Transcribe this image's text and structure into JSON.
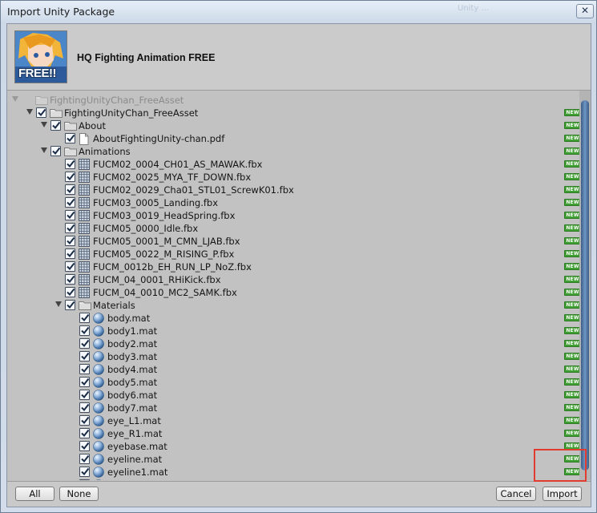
{
  "window": {
    "title": "Import Unity Package",
    "close_glyph": "✕",
    "background_text": "Unity ..."
  },
  "package": {
    "title": "HQ Fighting Animation FREE",
    "icon_badge": "FREE!!"
  },
  "new_badge": "NEW",
  "tree": [
    {
      "label": "FightingUnityChan_FreeAsset",
      "depth": 0,
      "kind": "folder",
      "expanded": true,
      "checked": null,
      "dim": true,
      "is_new": false
    },
    {
      "label": "FightingUnityChan_FreeAsset",
      "depth": 1,
      "kind": "folder",
      "expanded": true,
      "checked": true,
      "dim": false,
      "is_new": true
    },
    {
      "label": "About",
      "depth": 2,
      "kind": "folder",
      "expanded": true,
      "checked": true,
      "dim": false,
      "is_new": true
    },
    {
      "label": "AboutFightingUnity-chan.pdf",
      "depth": 3,
      "kind": "file",
      "checked": true,
      "dim": false,
      "is_new": true
    },
    {
      "label": "Animations",
      "depth": 2,
      "kind": "folder",
      "expanded": true,
      "checked": true,
      "dim": false,
      "is_new": true
    },
    {
      "label": "FUCM02_0004_CH01_AS_MAWAK.fbx",
      "depth": 3,
      "kind": "fbx",
      "checked": true,
      "dim": false,
      "is_new": true
    },
    {
      "label": "FUCM02_0025_MYA_TF_DOWN.fbx",
      "depth": 3,
      "kind": "fbx",
      "checked": true,
      "dim": false,
      "is_new": true
    },
    {
      "label": "FUCM02_0029_Cha01_STL01_ScrewK01.fbx",
      "depth": 3,
      "kind": "fbx",
      "checked": true,
      "dim": false,
      "is_new": true
    },
    {
      "label": "FUCM03_0005_Landing.fbx",
      "depth": 3,
      "kind": "fbx",
      "checked": true,
      "dim": false,
      "is_new": true
    },
    {
      "label": "FUCM03_0019_HeadSpring.fbx",
      "depth": 3,
      "kind": "fbx",
      "checked": true,
      "dim": false,
      "is_new": true
    },
    {
      "label": "FUCM05_0000_Idle.fbx",
      "depth": 3,
      "kind": "fbx",
      "checked": true,
      "dim": false,
      "is_new": true
    },
    {
      "label": "FUCM05_0001_M_CMN_LJAB.fbx",
      "depth": 3,
      "kind": "fbx",
      "checked": true,
      "dim": false,
      "is_new": true
    },
    {
      "label": "FUCM05_0022_M_RISING_P.fbx",
      "depth": 3,
      "kind": "fbx",
      "checked": true,
      "dim": false,
      "is_new": true
    },
    {
      "label": "FUCM_0012b_EH_RUN_LP_NoZ.fbx",
      "depth": 3,
      "kind": "fbx",
      "checked": true,
      "dim": false,
      "is_new": true
    },
    {
      "label": "FUCM_04_0001_RHiKick.fbx",
      "depth": 3,
      "kind": "fbx",
      "checked": true,
      "dim": false,
      "is_new": true
    },
    {
      "label": "FUCM_04_0010_MC2_SAMK.fbx",
      "depth": 3,
      "kind": "fbx",
      "checked": true,
      "dim": false,
      "is_new": true
    },
    {
      "label": "Materials",
      "depth": 3,
      "kind": "folder",
      "expanded": true,
      "checked": true,
      "dim": false,
      "is_new": true
    },
    {
      "label": "body.mat",
      "depth": 4,
      "kind": "mat",
      "checked": true,
      "dim": false,
      "is_new": true
    },
    {
      "label": "body1.mat",
      "depth": 4,
      "kind": "mat",
      "checked": true,
      "dim": false,
      "is_new": true
    },
    {
      "label": "body2.mat",
      "depth": 4,
      "kind": "mat",
      "checked": true,
      "dim": false,
      "is_new": true
    },
    {
      "label": "body3.mat",
      "depth": 4,
      "kind": "mat",
      "checked": true,
      "dim": false,
      "is_new": true
    },
    {
      "label": "body4.mat",
      "depth": 4,
      "kind": "mat",
      "checked": true,
      "dim": false,
      "is_new": true
    },
    {
      "label": "body5.mat",
      "depth": 4,
      "kind": "mat",
      "checked": true,
      "dim": false,
      "is_new": true
    },
    {
      "label": "body6.mat",
      "depth": 4,
      "kind": "mat",
      "checked": true,
      "dim": false,
      "is_new": true
    },
    {
      "label": "body7.mat",
      "depth": 4,
      "kind": "mat",
      "checked": true,
      "dim": false,
      "is_new": true
    },
    {
      "label": "eye_L1.mat",
      "depth": 4,
      "kind": "mat",
      "checked": true,
      "dim": false,
      "is_new": true
    },
    {
      "label": "eye_R1.mat",
      "depth": 4,
      "kind": "mat",
      "checked": true,
      "dim": false,
      "is_new": true
    },
    {
      "label": "eyebase.mat",
      "depth": 4,
      "kind": "mat",
      "checked": true,
      "dim": false,
      "is_new": true
    },
    {
      "label": "eyeline.mat",
      "depth": 4,
      "kind": "mat",
      "checked": true,
      "dim": false,
      "is_new": true
    },
    {
      "label": "eyeline1.mat",
      "depth": 4,
      "kind": "mat",
      "checked": true,
      "dim": false,
      "is_new": true
    },
    {
      "label": "",
      "depth": 4,
      "kind": "mat",
      "checked": true,
      "dim": false,
      "is_new": true
    }
  ],
  "buttons": {
    "all": "All",
    "none": "None",
    "cancel": "Cancel",
    "import": "Import"
  },
  "colors": {
    "highlight": "#e23b2f",
    "badge": "#3f9f32",
    "scroll_thumb": "#4f76a6"
  }
}
